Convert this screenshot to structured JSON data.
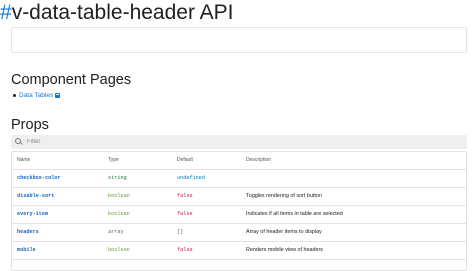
{
  "page": {
    "hash": "#",
    "title": "v-data-table-header API"
  },
  "sections": {
    "component_pages": "Component Pages",
    "props": "Props"
  },
  "component_pages": [
    {
      "label": "Data Tables",
      "icon": "external-link-icon"
    }
  ],
  "filter": {
    "placeholder": "Filter",
    "value": ""
  },
  "table": {
    "columns": [
      "Name",
      "Type",
      "Default",
      "Description"
    ],
    "rows": [
      {
        "name": "checkbox-color",
        "type": "string",
        "default": "undefined",
        "description": ""
      },
      {
        "name": "disable-sort",
        "type": "boolean",
        "default": "false",
        "description": "Toggles rendering of sort button"
      },
      {
        "name": "every-item",
        "type": "boolean",
        "default": "false",
        "description": "Indicates if all items in table are selected"
      },
      {
        "name": "headers",
        "type": "array",
        "default": "[]",
        "description": "Array of header items to display"
      },
      {
        "name": "mobile",
        "type": "boolean",
        "default": "false",
        "description": "Renders mobile view of headers"
      },
      {
        "name": "",
        "type": "",
        "default": "",
        "description": ""
      }
    ]
  },
  "colors": {
    "accent": "#1976d2",
    "name": "#1565c0",
    "string": "#2e7d32",
    "boolean": "#689f38",
    "undefined": "#0277bd",
    "false": "#c2185b",
    "array": "#616161",
    "array_default": "#616161"
  }
}
